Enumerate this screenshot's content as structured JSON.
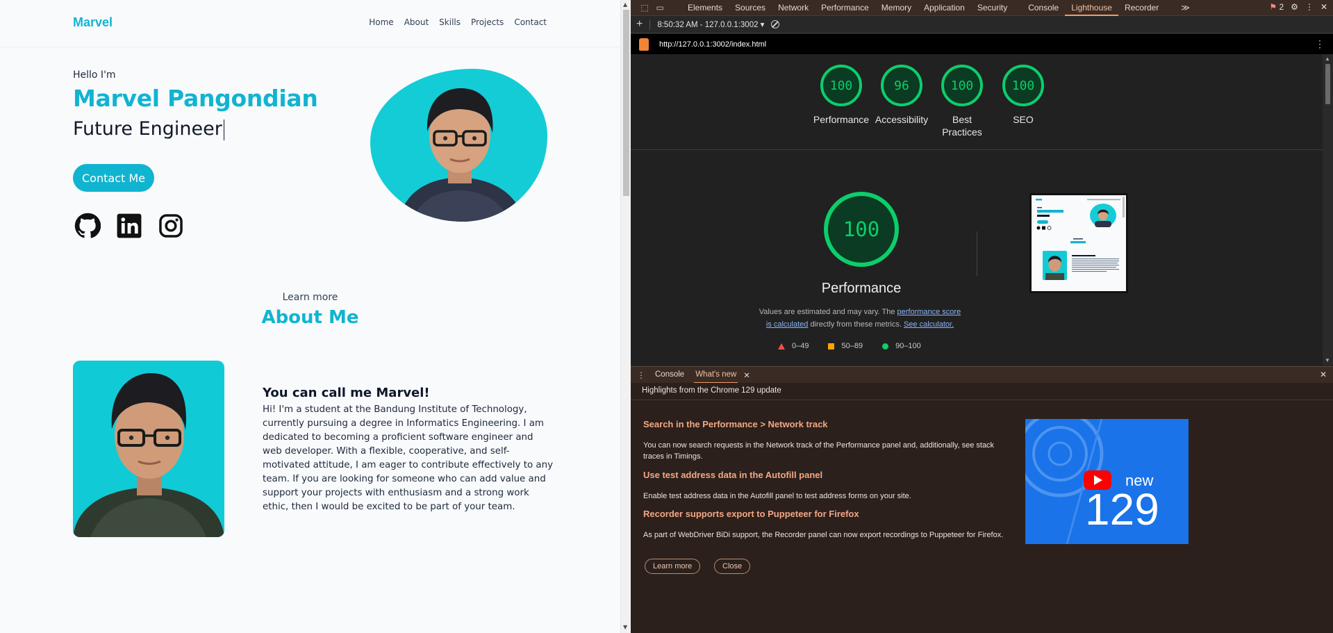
{
  "site": {
    "brand": "Marvel",
    "nav": [
      "Home",
      "About",
      "Skills",
      "Projects",
      "Contact"
    ],
    "hero": {
      "greeting": "Hello I'm",
      "name": "Marvel Pangondian",
      "role": "Future Engineer",
      "cta": "Contact Me",
      "socials": [
        "github-icon",
        "linkedin-icon",
        "instagram-icon"
      ]
    },
    "about": {
      "eyebrow": "Learn more",
      "title": "About Me",
      "heading": "You can call me Marvel!",
      "body": "Hi! I'm a student at the Bandung Institute of Technology, currently pursuing a degree in Informatics Engineering. I am dedicated to becoming a proficient software engineer and web developer. With a flexible, cooperative, and self-motivated attitude, I am eager to contribute effectively to any team. If you are looking for someone who can add value and support your projects with enthusiasm and a strong work ethic, then I would be excited to be part of your team."
    },
    "colors": {
      "accent": "#11b4d0",
      "photo_bg": "#14ccd6"
    }
  },
  "devtools": {
    "tabs": [
      "Elements",
      "Sources",
      "Network",
      "Performance",
      "Memory",
      "Application",
      "Security",
      "Console",
      "Lighthouse",
      "Recorder"
    ],
    "active_tab": "Lighthouse",
    "more_tabs": "≫",
    "issues_count": "2",
    "report_time": "8:50:32 AM - 127.0.0.1:3002 ▾",
    "url": "http://127.0.0.1:3002/index.html",
    "scores": [
      {
        "label": "Performance",
        "score": "100"
      },
      {
        "label": "Accessibility",
        "score": "96"
      },
      {
        "label": "Best Practices",
        "score": "100"
      },
      {
        "label": "SEO",
        "score": "100"
      }
    ],
    "main_score": {
      "score": "100",
      "label": "Performance"
    },
    "disclaimer": {
      "pre": "Values are estimated and may vary. The ",
      "link1": "performance score is calculated",
      "mid": " directly from these metrics. ",
      "link2": "See calculator."
    },
    "legend": [
      "0–49",
      "50–89",
      "90–100"
    ],
    "colors": {
      "pass": "#0cce6b",
      "average": "#ffa400",
      "fail": "#ff4e42",
      "accent_tab": "#f29b6c"
    },
    "drawer": {
      "tabs": [
        "Console",
        "What's new"
      ],
      "active": "What's new",
      "header": "Highlights from the Chrome 129 update",
      "items": [
        {
          "title": "Search in the Performance > Network track",
          "desc": "You can now search requests in the Network track of the Performance panel and, additionally, see stack traces in Timings."
        },
        {
          "title": "Use test address data in the Autofill panel",
          "desc": "Enable test address data in the Autofill panel to test address forms on your site."
        },
        {
          "title": "Recorder supports export to Puppeteer for Firefox",
          "desc": "As part of WebDriver BiDi support, the Recorder panel can now export recordings to Puppeteer for Firefox."
        }
      ],
      "video": {
        "word": "new",
        "version": "129"
      },
      "learn_more": "Learn more",
      "close": "Close"
    }
  }
}
